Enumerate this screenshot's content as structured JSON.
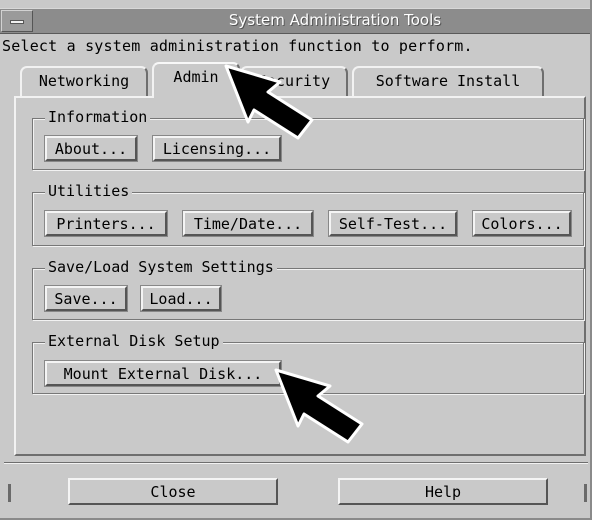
{
  "window": {
    "title": "System Administration Tools",
    "instructions": "Select a system administration function to perform."
  },
  "tabs": [
    {
      "label": "Networking",
      "active": false
    },
    {
      "label": "Admin",
      "active": true
    },
    {
      "label": "Security",
      "active": false
    },
    {
      "label": "Software Install",
      "active": false
    }
  ],
  "groups": {
    "information": {
      "label": "Information",
      "buttons": [
        "About...",
        "Licensing..."
      ]
    },
    "utilities": {
      "label": "Utilities",
      "buttons": [
        "Printers...",
        "Time/Date...",
        "Self-Test...",
        "Colors..."
      ]
    },
    "settings": {
      "label": "Save/Load System Settings",
      "buttons": [
        "Save...",
        "Load..."
      ]
    },
    "disk": {
      "label": "External Disk Setup",
      "buttons": [
        "Mount External Disk..."
      ]
    }
  },
  "footer": {
    "close_label": "Close",
    "help_label": "Help"
  },
  "icons": {
    "window_menu": "window-menu-icon",
    "pointer": "mouse-pointer-icon"
  },
  "colors": {
    "window_bg": "#c9c9c9",
    "titlebar_bg": "#8c8c8c"
  }
}
